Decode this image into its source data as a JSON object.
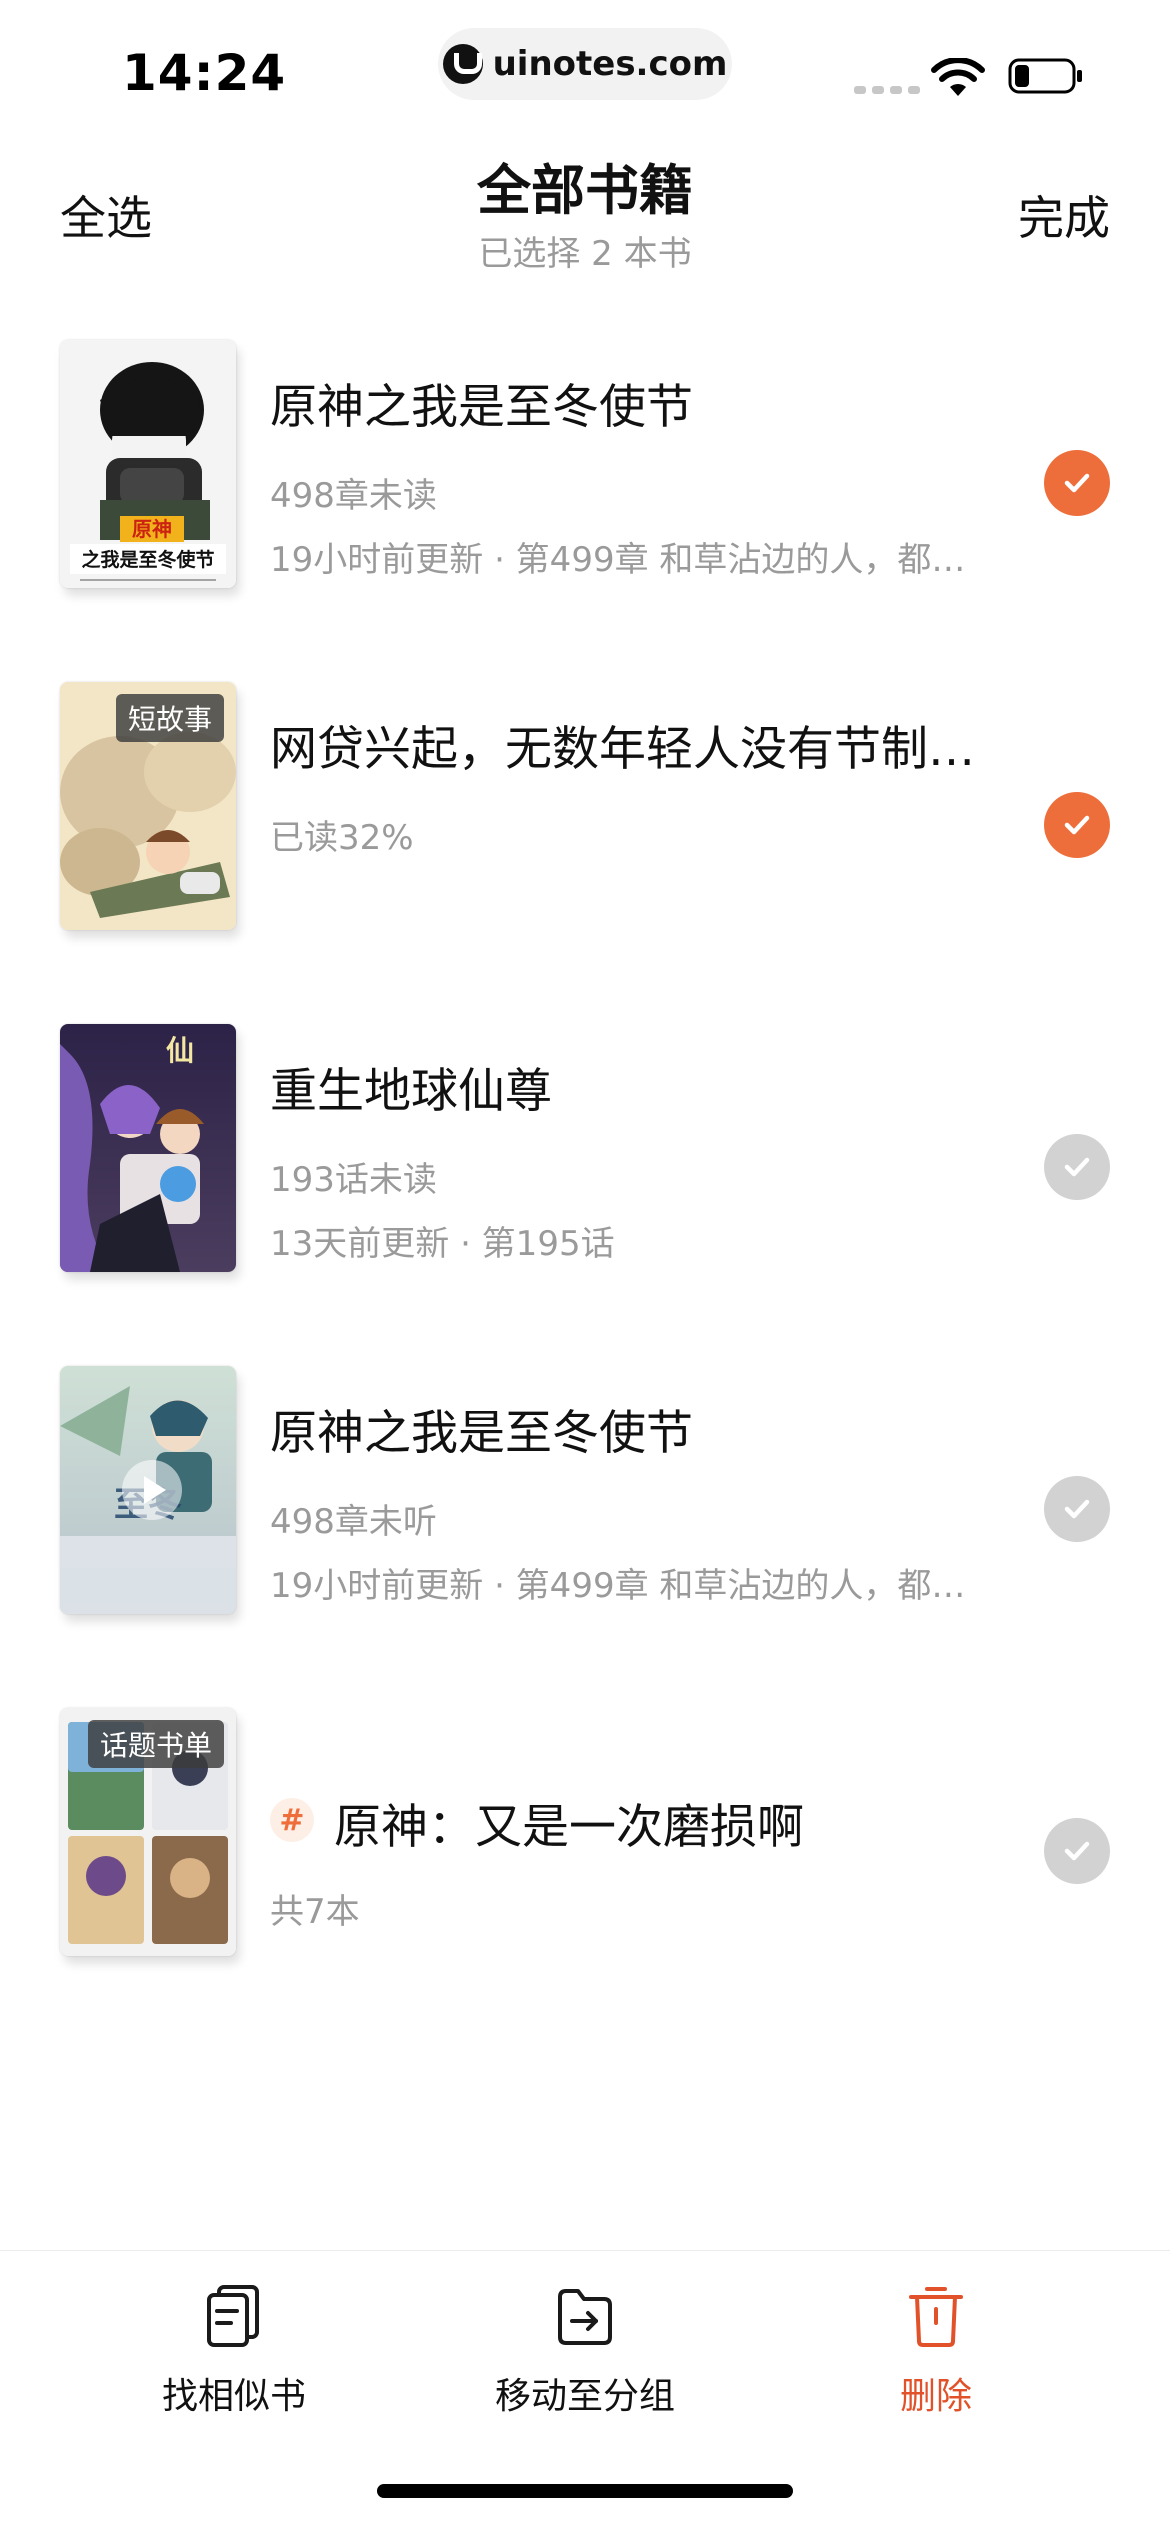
{
  "status_bar": {
    "time": "14:24",
    "url": "uinotes.com"
  },
  "header": {
    "left_action": "全选",
    "title": "全部书籍",
    "subtitle": "已选择 2 本书",
    "right_action": "完成"
  },
  "books": [
    {
      "title": "原神之我是至冬使节",
      "meta1": "498章未读",
      "meta2": "19小时前更新 · 第499章 和草沾边的人，都…",
      "selected": true,
      "cover_tag": "",
      "cover_text": "原神",
      "cover_text2": "之我是至冬使节"
    },
    {
      "title": "网贷兴起，无数年轻人没有节制…",
      "meta1": "已读32%",
      "meta2": "",
      "selected": true,
      "cover_tag": "短故事"
    },
    {
      "title": "重生地球仙尊",
      "meta1": "193话未读",
      "meta2": "13天前更新 · 第195话",
      "selected": false,
      "cover_tag": ""
    },
    {
      "title": "原神之我是至冬使节",
      "meta1": "498章未听",
      "meta2": "19小时前更新 · 第499章 和草沾边的人，都…",
      "selected": false,
      "cover_tag": ""
    },
    {
      "title": "原神：又是一次磨损啊",
      "meta1": "共7本",
      "meta2": "",
      "selected": false,
      "cover_tag": "话题书单",
      "hash": "#"
    }
  ],
  "toolbar": {
    "find_similar": "找相似书",
    "move_group": "移动至分组",
    "delete": "删除"
  },
  "colors": {
    "accent": "#ee6e3b",
    "danger": "#e2522a",
    "muted_text": "#9a9a9a",
    "check_off": "#d2d2d2"
  }
}
